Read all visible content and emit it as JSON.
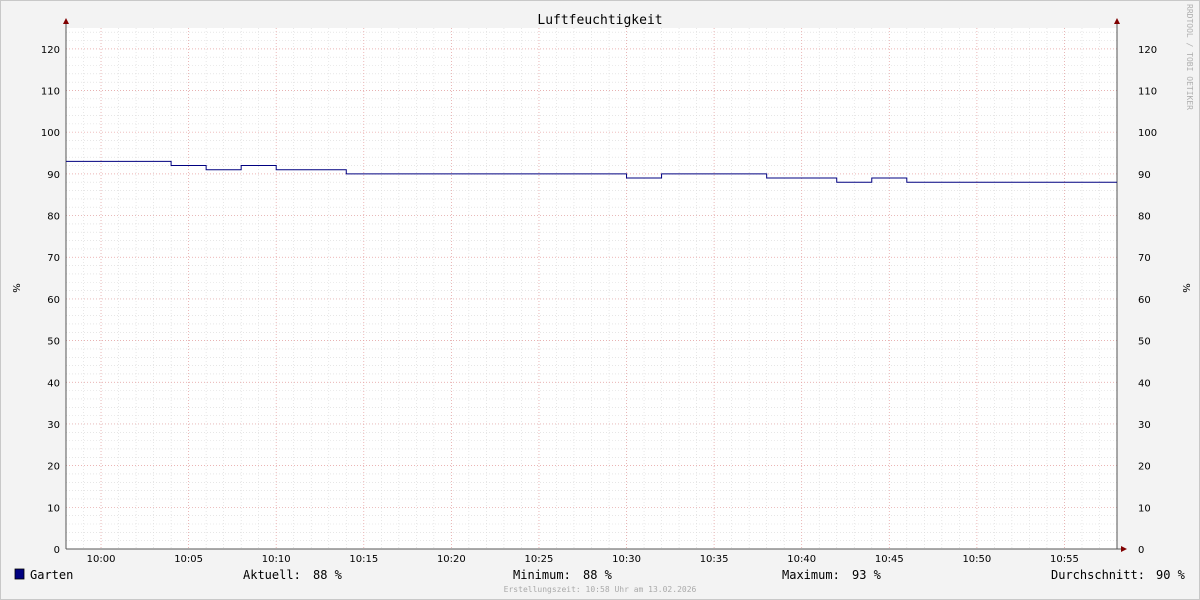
{
  "chart_data": {
    "type": "line",
    "title": "Luftfeuchtigkeit",
    "ylabel": "%",
    "ylim": [
      0,
      125
    ],
    "y_ticks": [
      0,
      10,
      20,
      30,
      40,
      50,
      60,
      70,
      80,
      90,
      100,
      110,
      120
    ],
    "x_range": [
      "09:58",
      "10:58"
    ],
    "x_ticks": [
      "10:00",
      "10:05",
      "10:10",
      "10:15",
      "10:20",
      "10:25",
      "10:30",
      "10:35",
      "10:40",
      "10:45",
      "10:50",
      "10:55"
    ],
    "grid": true,
    "series": [
      {
        "name": "Garten",
        "color": "#000080",
        "points": [
          {
            "t": "09:58",
            "v": 93
          },
          {
            "t": "10:04",
            "v": 92
          },
          {
            "t": "10:06",
            "v": 91
          },
          {
            "t": "10:08",
            "v": 92
          },
          {
            "t": "10:10",
            "v": 91
          },
          {
            "t": "10:14",
            "v": 90
          },
          {
            "t": "10:30",
            "v": 89
          },
          {
            "t": "10:32",
            "v": 90
          },
          {
            "t": "10:38",
            "v": 89
          },
          {
            "t": "10:42",
            "v": 88
          },
          {
            "t": "10:44",
            "v": 89
          },
          {
            "t": "10:46",
            "v": 88
          },
          {
            "t": "10:58",
            "v": 88
          }
        ]
      }
    ],
    "watermark": "RRDTOOL / TOBI OETIKER"
  },
  "legend": {
    "series_name": "Garten",
    "series_color": "#000080",
    "stats": [
      {
        "label": "Aktuell:",
        "value": "88 %"
      },
      {
        "label": "Minimum:",
        "value": "88 %"
      },
      {
        "label": "Maximum:",
        "value": "93 %"
      },
      {
        "label": "Durchschnitt:",
        "value": "90 %"
      }
    ]
  },
  "footer": {
    "created": "Erstellungszeit: 10:58 Uhr am 13.02.2026"
  }
}
